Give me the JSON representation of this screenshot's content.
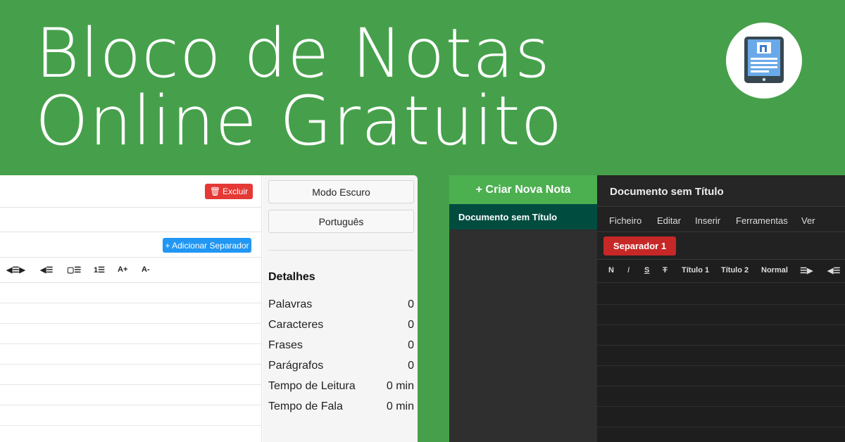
{
  "hero": {
    "title_line1": "Bloco de Notas",
    "title_line2": "Online Gratuito"
  },
  "light_app": {
    "delete_button": "Excluir",
    "add_separator_button": "+ Adicionar Separador",
    "toolbar": [
      "◀☰▶",
      "◀☰",
      "▢☰",
      "1☰",
      "A+",
      "A-"
    ],
    "sidebar": {
      "dark_mode_button": "Modo Escuro",
      "language_button": "Português",
      "details_title": "Detalhes",
      "details": [
        {
          "label": "Palavras",
          "value": "0"
        },
        {
          "label": "Caracteres",
          "value": "0"
        },
        {
          "label": "Frases",
          "value": "0"
        },
        {
          "label": "Parágrafos",
          "value": "0"
        },
        {
          "label": "Tempo de Leitura",
          "value": "0 min"
        },
        {
          "label": "Tempo de Fala",
          "value": "0 min"
        }
      ]
    }
  },
  "dark_app": {
    "create_note_button": "+ Criar Nova Nota",
    "note_list": [
      {
        "title": "Documento sem Título"
      }
    ],
    "document_title": "Documento sem Título",
    "menu": [
      "Ficheiro",
      "Editar",
      "Inserir",
      "Ferramentas",
      "Ver"
    ],
    "tabs": [
      {
        "label": "Separador 1"
      }
    ],
    "toolbar": [
      "N",
      "I",
      "S",
      "T",
      "Título 1",
      "Título 2",
      "Normal",
      "☰▶",
      "◀☰"
    ]
  },
  "colors": {
    "background_green": "#46a04b",
    "delete_red": "#e53935",
    "separator_blue": "#2196f3",
    "create_green": "#4caf50",
    "note_teal": "#004d40",
    "tab_red": "#c62828"
  }
}
